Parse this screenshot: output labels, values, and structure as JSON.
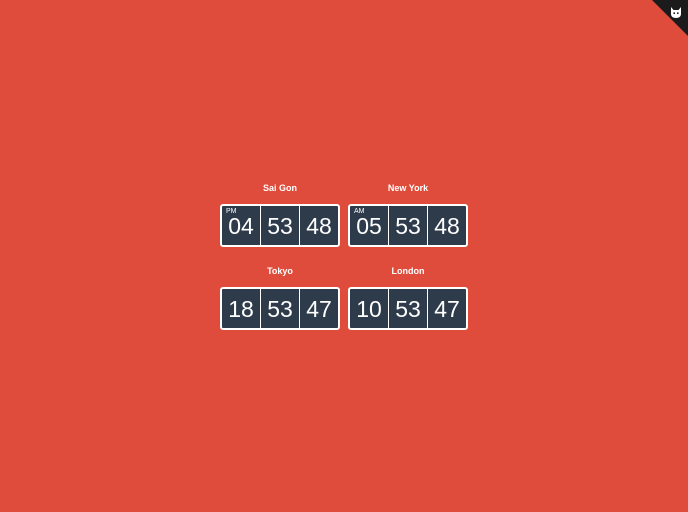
{
  "clocks": [
    {
      "city": "Sai Gon",
      "period": "PM",
      "hours": "04",
      "minutes": "53",
      "seconds": "48"
    },
    {
      "city": "New York",
      "period": "AM",
      "hours": "05",
      "minutes": "53",
      "seconds": "48"
    },
    {
      "city": "Tokyo",
      "period": "",
      "hours": "18",
      "minutes": "53",
      "seconds": "47"
    },
    {
      "city": "London",
      "period": "",
      "hours": "10",
      "minutes": "53",
      "seconds": "47"
    }
  ],
  "corner": {
    "icon": "cat-icon"
  },
  "colors": {
    "background": "#e04c3b",
    "face": "#2e3b4a",
    "text": "#ffffff",
    "corner": "#1b1b1b"
  }
}
